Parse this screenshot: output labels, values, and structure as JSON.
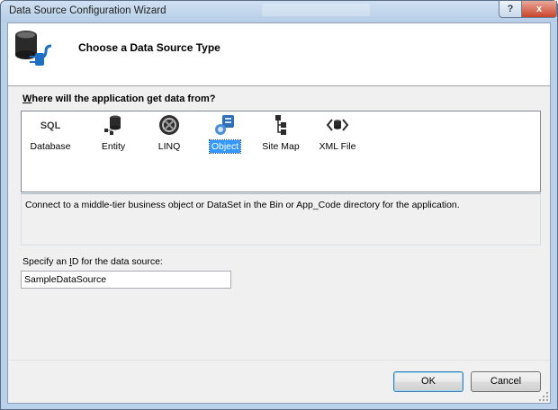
{
  "window": {
    "title": "Data Source Configuration Wizard",
    "help_glyph": "?",
    "close_glyph": "x"
  },
  "header": {
    "title": "Choose a Data Source Type"
  },
  "question": {
    "label_prefix": "",
    "label_accel": "W",
    "label_rest": "here will the application get data from?"
  },
  "types": [
    {
      "label": "Database",
      "icon": "sql-database-icon",
      "icon_text": "SQL",
      "selected": false
    },
    {
      "label": "Entity",
      "icon": "entity-icon",
      "selected": false
    },
    {
      "label": "LINQ",
      "icon": "linq-icon",
      "selected": false
    },
    {
      "label": "Object",
      "icon": "object-icon",
      "selected": true
    },
    {
      "label": "Site Map",
      "icon": "site-map-icon",
      "selected": false
    },
    {
      "label": "XML File",
      "icon": "xml-file-icon",
      "selected": false
    }
  ],
  "description": "Connect to a middle-tier business object or DataSet in the Bin or App_Code directory for the application.",
  "id_field": {
    "label_before": "Specify an ",
    "label_accel": "I",
    "label_after": "D for the data source:",
    "value": "SampleDataSource"
  },
  "buttons": {
    "ok": "OK",
    "cancel": "Cancel"
  },
  "colors": {
    "selection": "#3399ff",
    "title_bar": "#b9d1ea",
    "close_button": "#c8442b"
  }
}
